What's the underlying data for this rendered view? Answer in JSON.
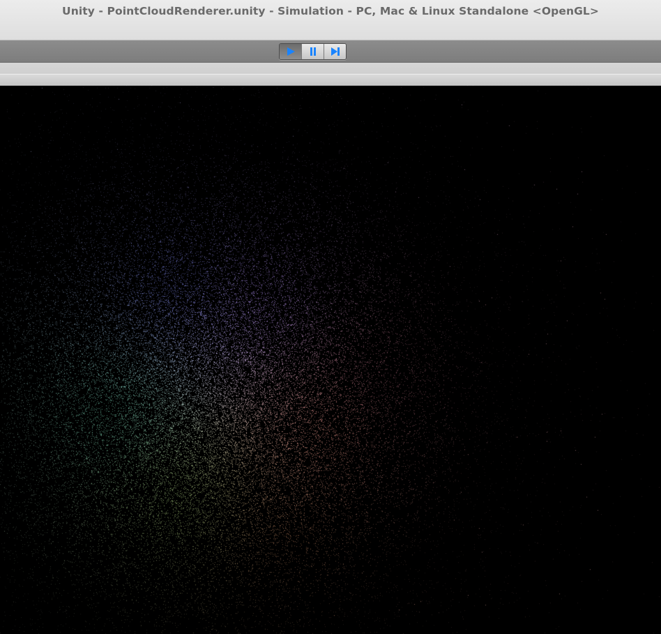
{
  "window": {
    "title": "Unity - PointCloudRenderer.unity - Simulation - PC, Mac & Linux Standalone <OpenGL>"
  },
  "toolbar": {
    "controls": [
      {
        "name": "play",
        "icon": "play-icon",
        "active": true
      },
      {
        "name": "pause",
        "icon": "pause-icon",
        "active": false
      },
      {
        "name": "step",
        "icon": "step-icon",
        "active": false
      }
    ],
    "icon_color": "#1a84ff"
  },
  "game_view": {
    "background": "#000000",
    "content": "point-cloud",
    "color_regions": [
      "#6f7dff",
      "#b085ff",
      "#5fd2aa",
      "#9fd46a",
      "#ff9a7a",
      "#ff8f6a"
    ]
  }
}
